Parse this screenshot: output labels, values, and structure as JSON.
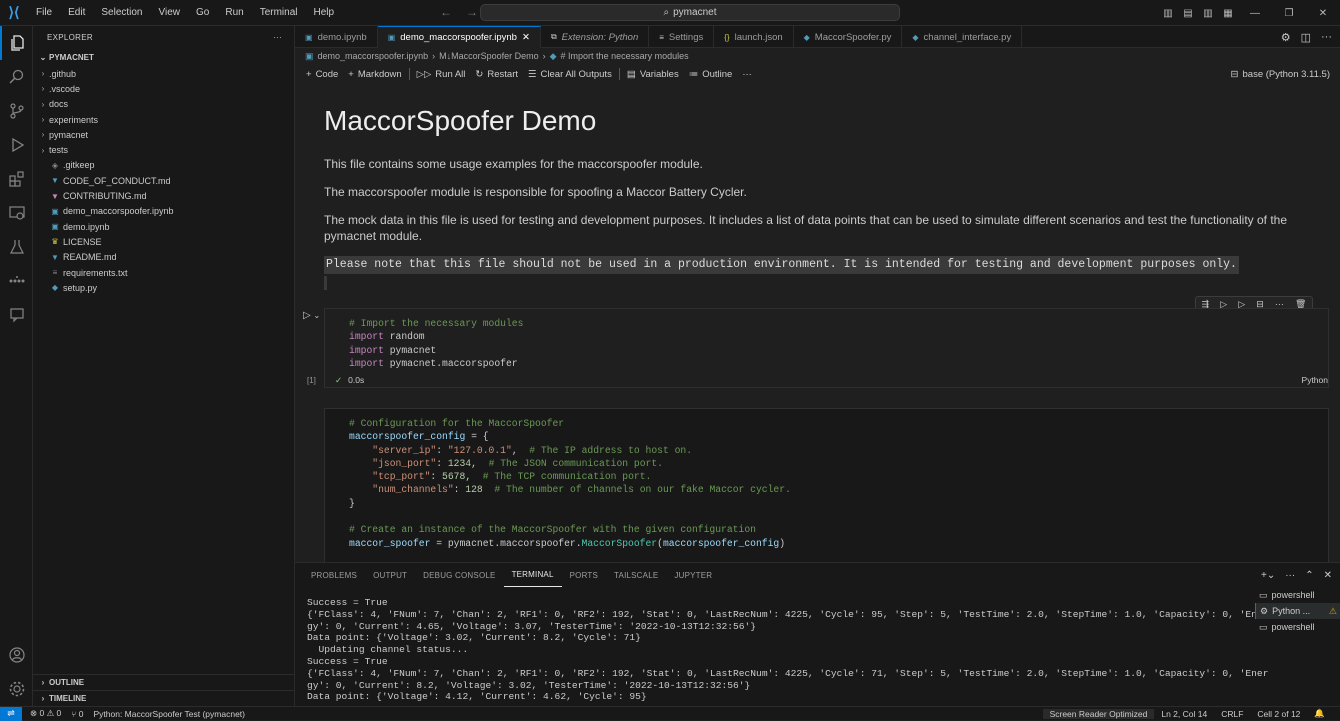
{
  "titlebar": {
    "menu": [
      "File",
      "Edit",
      "Selection",
      "View",
      "Go",
      "Run",
      "Terminal",
      "Help"
    ],
    "search_text": "pymacnet"
  },
  "sidebar": {
    "title": "EXPLORER",
    "root": "PYMACNET",
    "items": [
      {
        "label": ".github",
        "type": "folder"
      },
      {
        "label": ".vscode",
        "type": "folder"
      },
      {
        "label": "docs",
        "type": "folder"
      },
      {
        "label": "experiments",
        "type": "folder"
      },
      {
        "label": "pymacnet",
        "type": "folder"
      },
      {
        "label": "tests",
        "type": "folder"
      },
      {
        "label": ".gitkeep",
        "type": "file",
        "icon": "gitkeep-icon",
        "color": "#8a8a8a"
      },
      {
        "label": "CODE_OF_CONDUCT.md",
        "type": "file",
        "icon": "markdown-icon",
        "color": "#519aba"
      },
      {
        "label": "CONTRIBUTING.md",
        "type": "file",
        "icon": "markdown-icon",
        "color": "#c586c0"
      },
      {
        "label": "demo_maccorspoofer.ipynb",
        "type": "file",
        "icon": "notebook-icon",
        "color": "#519aba"
      },
      {
        "label": "demo.ipynb",
        "type": "file",
        "icon": "notebook-icon",
        "color": "#519aba"
      },
      {
        "label": "LICENSE",
        "type": "file",
        "icon": "license-icon",
        "color": "#cbcb41"
      },
      {
        "label": "README.md",
        "type": "file",
        "icon": "markdown-icon",
        "color": "#519aba"
      },
      {
        "label": "requirements.txt",
        "type": "file",
        "icon": "text-file-icon",
        "color": "#8a8a8a"
      },
      {
        "label": "setup.py",
        "type": "file",
        "icon": "python-icon",
        "color": "#519aba"
      }
    ],
    "outline": "OUTLINE",
    "timeline": "TIMELINE"
  },
  "tabs": [
    {
      "label": "demo.ipynb",
      "icon": "notebook-icon",
      "active": false
    },
    {
      "label": "demo_maccorspoofer.ipynb",
      "icon": "notebook-icon",
      "active": true
    },
    {
      "label": "Extension: Python",
      "icon": "extension-icon",
      "active": false,
      "italic": true
    },
    {
      "label": "Settings",
      "icon": "settings-icon",
      "active": false
    },
    {
      "label": "launch.json",
      "icon": "json-icon",
      "active": false
    },
    {
      "label": "MaccorSpoofer.py",
      "icon": "python-icon",
      "active": false
    },
    {
      "label": "channel_interface.py",
      "icon": "python-icon",
      "active": false
    }
  ],
  "breadcrumb": [
    "demo_maccorspoofer.ipynb",
    "M↓MaccorSpoofer Demo",
    "# Import the necessary modules"
  ],
  "toolbar": {
    "code": "Code",
    "markdown": "Markdown",
    "run_all": "Run All",
    "restart": "Restart",
    "clear": "Clear All Outputs",
    "variables": "Variables",
    "outline": "Outline",
    "kernel": "base (Python 3.11.5)"
  },
  "markdown": {
    "title": "MaccorSpoofer Demo",
    "p1": "This file contains some usage examples for the maccorspoofer module.",
    "p2": "The maccorspoofer module is responsible for spoofing a Maccor Battery Cycler.",
    "p3": "The mock data in this file is used for testing and development purposes. It includes a list of data points that can be used to simulate different scenarios and test the functionality of the pymacnet module.",
    "note": "Please note that this file should not be used in a production environment. It is intended for testing and development purposes only."
  },
  "cell1": {
    "exec_count": "[1]",
    "time": "0.0s",
    "language": "Python"
  },
  "panel": {
    "tabs": [
      "PROBLEMS",
      "OUTPUT",
      "DEBUG CONSOLE",
      "TERMINAL",
      "PORTS",
      "TAILSCALE",
      "JUPYTER"
    ],
    "active_tab": "TERMINAL",
    "terminal_lines": [
      "Success = True",
      "{'FClass': 4, 'FNum': 7, 'Chan': 2, 'RF1': 0, 'RF2': 192, 'Stat': 0, 'LastRecNum': 4225, 'Cycle': 95, 'Step': 5, 'TestTime': 2.0, 'StepTime': 1.0, 'Capacity': 0, 'Ener",
      "gy': 0, 'Current': 4.65, 'Voltage': 3.07, 'TesterTime': '2022-10-13T12:32:56'}",
      "Data point: {'Voltage': 3.02, 'Current': 8.2, 'Cycle': 71}",
      "  Updating channel status...",
      "Success = True",
      "{'FClass': 4, 'FNum': 7, 'Chan': 2, 'RF1': 0, 'RF2': 192, 'Stat': 0, 'LastRecNum': 4225, 'Cycle': 71, 'Step': 5, 'TestTime': 2.0, 'StepTime': 1.0, 'Capacity': 0, 'Ener",
      "gy': 0, 'Current': 8.2, 'Voltage': 3.02, 'TesterTime': '2022-10-13T12:32:56'}",
      "Data point: {'Voltage': 4.12, 'Current': 4.62, 'Cycle': 95}"
    ],
    "terminals": [
      {
        "label": "powershell",
        "active": false
      },
      {
        "label": "Python ...",
        "active": true
      },
      {
        "label": "powershell",
        "active": false
      }
    ]
  },
  "statusbar": {
    "problems": "⊗ 0 ⚠ 0",
    "ports": "⑂ 0",
    "interpreter": "Python: MaccorSpoofer Test (pymacnet)",
    "screen_reader": "Screen Reader Optimized",
    "position": "Ln 2, Col 14",
    "eol": "CRLF",
    "cell": "Cell 2 of 12"
  }
}
